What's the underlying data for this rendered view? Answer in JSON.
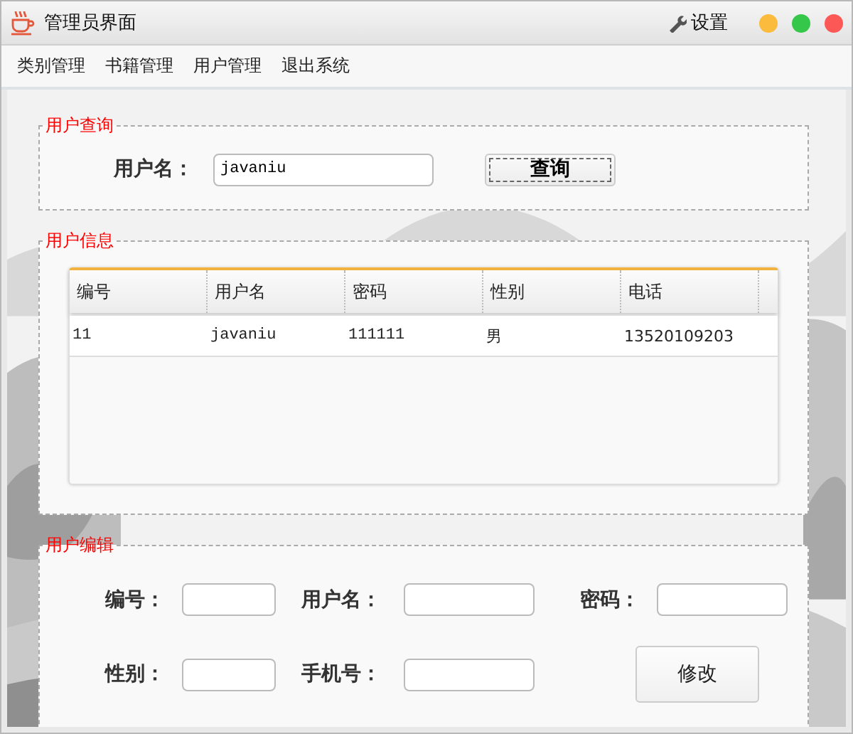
{
  "window": {
    "title": "管理员界面",
    "settings": "设置"
  },
  "menu": [
    "类别管理",
    "书籍管理",
    "用户管理",
    "退出系统"
  ],
  "query": {
    "title": "用户查询",
    "label": "用户名：",
    "value": "javaniu",
    "button": "查询"
  },
  "info": {
    "title": "用户信息",
    "columns": [
      "编号",
      "用户名",
      "密码",
      "性别",
      "电话"
    ],
    "rows": [
      [
        "11",
        "javaniu",
        "111111",
        "男",
        "13520109203"
      ]
    ]
  },
  "edit": {
    "title": "用户编辑",
    "fields": [
      {
        "label": "编号："
      },
      {
        "label": "用户名："
      },
      {
        "label": "密码："
      },
      {
        "label": "性别："
      },
      {
        "label": "手机号："
      }
    ],
    "button": "修改"
  }
}
